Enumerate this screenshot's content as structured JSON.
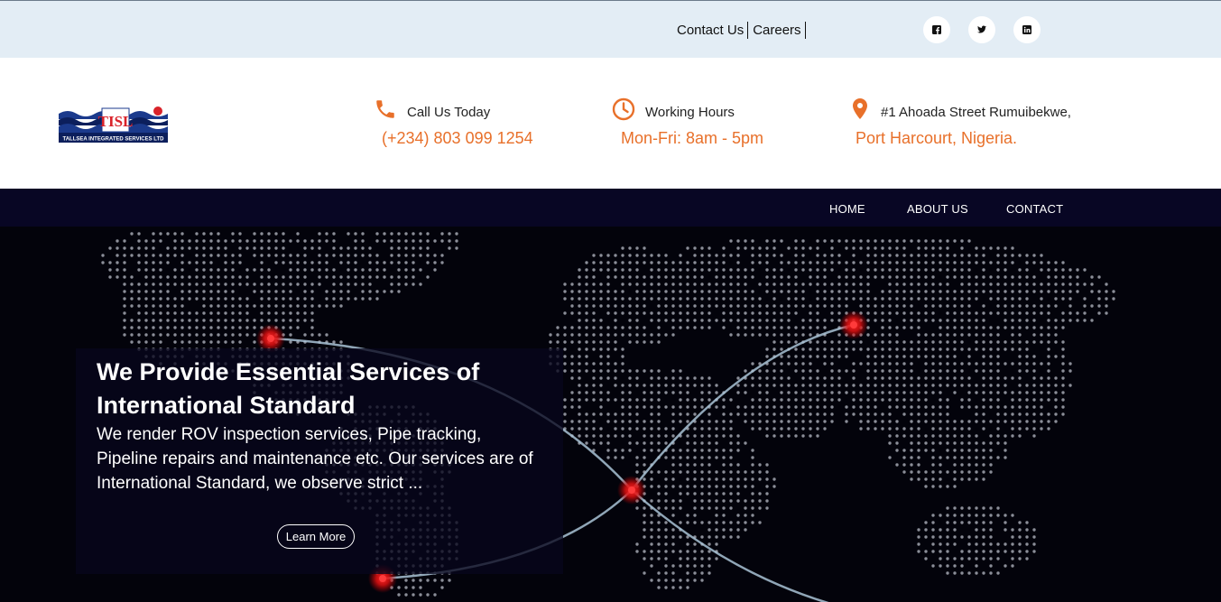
{
  "topbar": {
    "links": [
      "Contact Us",
      "Careers"
    ],
    "social": [
      {
        "name": "facebook-icon"
      },
      {
        "name": "twitter-icon"
      },
      {
        "name": "linkedin-icon"
      }
    ]
  },
  "header": {
    "logo": {
      "mark": "TISL",
      "text": "TALLSEA INTEGRATED SERVICES LTD"
    },
    "call": {
      "label": "Call Us Today",
      "value": "(+234) 803 099 1254",
      "icon": "phone-icon"
    },
    "hours": {
      "label": "Working Hours",
      "value": "Mon-Fri: 8am - 5pm",
      "icon": "clock-icon"
    },
    "address": {
      "label": "#1 Ahoada Street Rumuibekwe,",
      "value": "Port Harcourt, Nigeria.",
      "icon": "location-pin-icon"
    }
  },
  "nav": {
    "items": [
      "HOME",
      "ABOUT US",
      "CONTACT"
    ]
  },
  "hero": {
    "headline": "We Provide Essential Services of International Standard",
    "body": "We render ROV inspection services, Pipe tracking, Pipeline repairs and maintenance etc. Our services are of International Standard, we observe strict ...",
    "button": "Learn More"
  },
  "colors": {
    "accent": "#e8702a",
    "topbar": "#e3edf5",
    "hero_bg": "#03030b",
    "nav_bg": "#080624"
  }
}
